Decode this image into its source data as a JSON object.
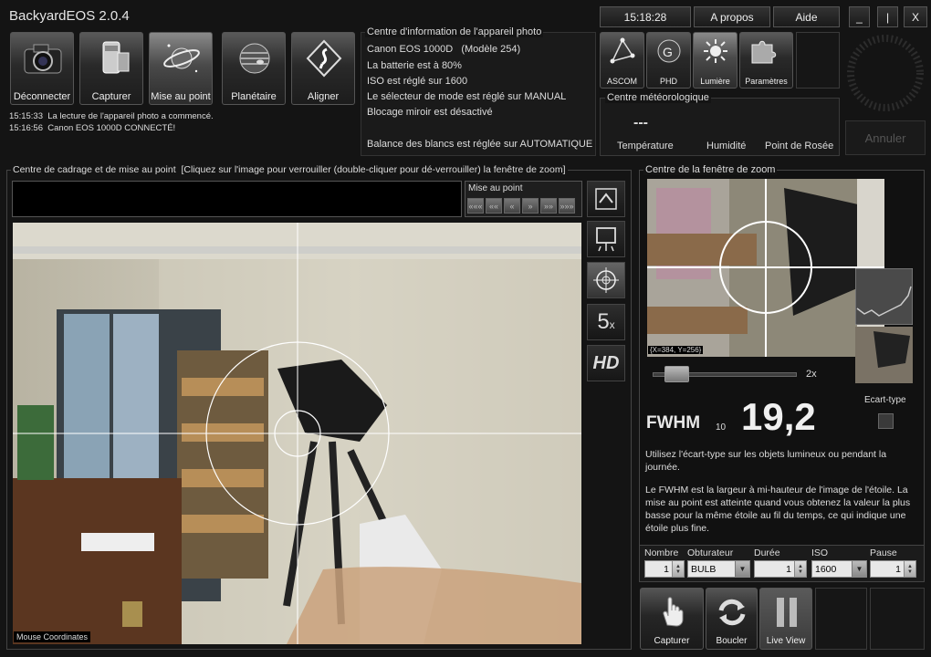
{
  "app": {
    "title": "BackyardEOS 2.0.4"
  },
  "header": {
    "clock": "15:18:28",
    "about_label": "A propos",
    "help_label": "Aide",
    "minimize": "_",
    "restore": "|",
    "close": "X"
  },
  "toolbar": {
    "buttons": [
      {
        "label": "Déconnecter",
        "icon": "camera-icon"
      },
      {
        "label": "Capturer",
        "icon": "film-roll-icon"
      },
      {
        "label": "Mise au point",
        "icon": "planet-ring-icon"
      },
      {
        "label": "Planétaire",
        "icon": "jupiter-icon"
      },
      {
        "label": "Aligner",
        "icon": "align-icon"
      }
    ]
  },
  "log": [
    {
      "time": "15:15:33",
      "text": "La lecture de l'appareil photo a commencé."
    },
    {
      "time": "15:16:56",
      "text": "Canon EOS 1000D CONNECTÉ!"
    }
  ],
  "camera_info": {
    "title": "Centre d'information de l'appareil photo",
    "model": "Canon EOS 1000D",
    "model_code": "(Modèle 254)",
    "lines": [
      "La batterie est à 80%",
      "ISO est réglé sur 1600",
      "Le sélecteur de mode est réglé sur MANUAL",
      "Blocage miroir est désactivé",
      "Balance des blancs est réglée sur AUTOMATIQUE"
    ]
  },
  "side_tools": [
    {
      "label": "ASCOM",
      "icon": "ascom-icon"
    },
    {
      "label": "PHD",
      "icon": "phd-icon"
    },
    {
      "label": "Lumière",
      "icon": "light-icon"
    },
    {
      "label": "Paramètres",
      "icon": "puzzle-icon"
    }
  ],
  "weather": {
    "title": "Centre météorologique",
    "value": "---",
    "labels": [
      "Température",
      "Humidité",
      "Point de Rosée"
    ]
  },
  "cancel_label": "Annuler",
  "framing": {
    "title": "Centre de cadrage et de mise au point",
    "hint": "[Cliquez sur l'image pour verrouiller (double-cliquer pour dé-verrouiller) la fenêtre de zoom]",
    "focus_label": "Mise au point",
    "nav_buttons": [
      "«««",
      "««",
      "«",
      "»",
      "»»",
      "»»»"
    ],
    "mouse_label": "Mouse Coordinates"
  },
  "view_tools": [
    {
      "icon": "triangle-up-icon"
    },
    {
      "icon": "easel-icon"
    },
    {
      "icon": "crosshair-icon"
    },
    {
      "label": "5",
      "suffix": "x",
      "icon": "zoom-5x-icon"
    },
    {
      "label": "HD",
      "icon": "hd-icon"
    }
  ],
  "zoom": {
    "title": "Centre de la fenêtre de zoom",
    "coords": "{X=384, Y=256}",
    "slider_label": "2x",
    "slider_value": 0.08
  },
  "fwhm": {
    "label": "FWHM",
    "sub": "10",
    "value": "19,2",
    "ecart_label": "Ecart-type"
  },
  "help_text": {
    "p1": "Utilisez l'écart-type sur les objets lumineux ou pendant la journée.",
    "p2": "Le FWHM est la largeur à mi-hauteur de l'image de l'étoile. La mise au point est atteinte quand vous obtenez la valeur la plus basse pour la même étoile au fil du temps, ce qui indique une étoile plus fine."
  },
  "capture_settings": {
    "labels": [
      "Nombre",
      "Obturateur",
      "Durée",
      "ISO",
      "Pause"
    ],
    "nombre": "1",
    "obturateur": "BULB",
    "duree": "1",
    "iso": "1600",
    "pause": "1"
  },
  "bottom_buttons": [
    {
      "label": "Capturer",
      "icon": "hand-icon"
    },
    {
      "label": "Boucler",
      "icon": "loop-icon"
    },
    {
      "label": "Live View",
      "icon": "pause-icon"
    }
  ]
}
